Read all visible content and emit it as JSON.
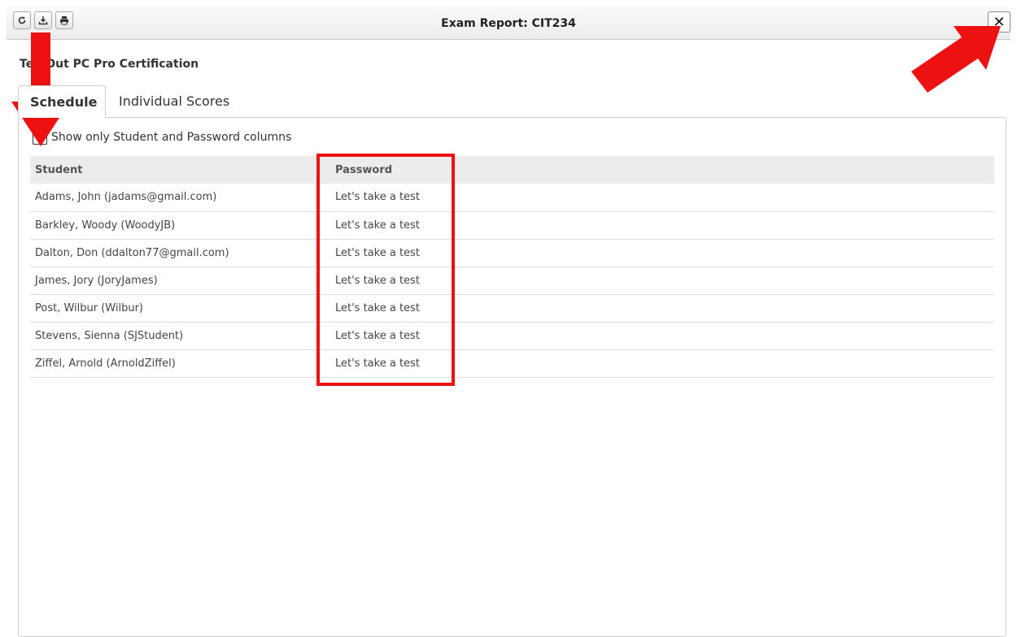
{
  "window": {
    "title": "Exam Report: CIT234",
    "toolbar": [
      {
        "icon": "refresh-icon"
      },
      {
        "icon": "download-icon"
      },
      {
        "icon": "print-icon"
      }
    ],
    "close_label": "✕"
  },
  "course_title": "TestOut PC Pro Certification",
  "tabs": [
    {
      "label": "Schedule",
      "active": true
    },
    {
      "label": "Individual Scores",
      "active": false
    }
  ],
  "filter": {
    "checked": true,
    "label": "Show only Student and Password columns"
  },
  "table": {
    "headers": [
      "Student",
      "Password"
    ],
    "rows": [
      [
        "Adams, John (jadams@gmail.com)",
        "Let's take a test"
      ],
      [
        "Barkley, Woody (WoodyJB)",
        "Let's take a test"
      ],
      [
        "Dalton, Don (ddalton77@gmail.com)",
        "Let's take a test"
      ],
      [
        "James, Jory (JoryJames)",
        "Let's take a test"
      ],
      [
        "Post, Wilbur (Wilbur)",
        "Let's take a test"
      ],
      [
        "Stevens, Sienna (SJStudent)",
        "Let's take a test"
      ],
      [
        "Ziffel, Arnold (ArnoldZiffel)",
        "Let's take a test"
      ]
    ]
  },
  "annotations": {
    "color": "#ee1111"
  }
}
